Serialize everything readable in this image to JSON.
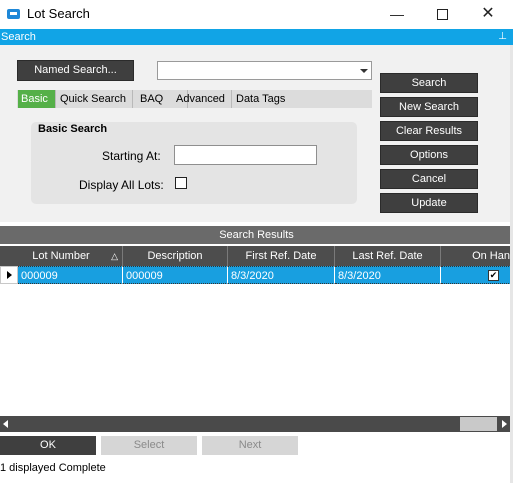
{
  "window": {
    "title": "Lot Search",
    "minimize": "—",
    "maximize": "",
    "close": "✕"
  },
  "header": {
    "label": "Search",
    "pin": "⊥"
  },
  "search": {
    "named_search_label": "Named Search...",
    "combo_value": "",
    "tabs": [
      {
        "label": "Basic",
        "active": true
      },
      {
        "label": "Quick Search",
        "active": false
      },
      {
        "label": "BAQ",
        "active": false
      },
      {
        "label": "Advanced",
        "active": false
      },
      {
        "label": "Data Tags",
        "active": false
      }
    ],
    "group_title": "Basic Search",
    "starting_at_label": "Starting At:",
    "starting_at_value": "",
    "display_all_lots_label": "Display All Lots:",
    "display_all_lots_checked": false
  },
  "actions": [
    "Search",
    "New Search",
    "Clear Results",
    "Options",
    "Cancel",
    "Update"
  ],
  "results": {
    "title": "Search Results",
    "columns": [
      "Lot Number",
      "Description",
      "First Ref. Date",
      "Last Ref. Date",
      "On Han"
    ],
    "sort_indicator": "△",
    "rows": [
      {
        "lot_number": "000009",
        "description": "000009",
        "first_ref_date": "8/3/2020",
        "last_ref_date": "8/3/2020",
        "on_hand": true
      }
    ]
  },
  "bottom": {
    "ok": "OK",
    "select": "Select",
    "next": "Next"
  },
  "status": "1 displayed Complete",
  "colors": {
    "accent": "#11a4e6",
    "tab_active": "#55b048",
    "button_dark": "#3f3f3f",
    "row_selected": "#189fe0"
  }
}
